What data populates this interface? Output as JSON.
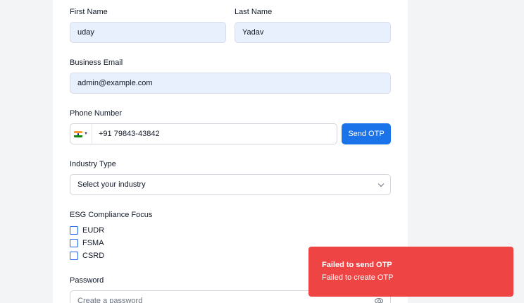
{
  "form": {
    "first_name": {
      "label": "First Name",
      "value": "uday"
    },
    "last_name": {
      "label": "Last Name",
      "value": "Yadav"
    },
    "email": {
      "label": "Business Email",
      "value": "admin@example.com"
    },
    "phone": {
      "label": "Phone Number",
      "value": "+91 79843-43842",
      "country": "India"
    },
    "send_otp_label": "Send OTP",
    "industry": {
      "label": "Industry Type",
      "value": "Select your industry"
    },
    "esg": {
      "label": "ESG Compliance Focus",
      "options": [
        {
          "label": "EUDR",
          "checked": false
        },
        {
          "label": "FSMA",
          "checked": false
        },
        {
          "label": "CSRD",
          "checked": false
        }
      ]
    },
    "password": {
      "label": "Password",
      "placeholder": "Create a password"
    }
  },
  "toast": {
    "title": "Failed to send OTP",
    "description": "Failed to create OTP",
    "color": "#ef4444"
  },
  "colors": {
    "accent": "#1a73e8",
    "autofill_bg": "#e8f0fe"
  }
}
